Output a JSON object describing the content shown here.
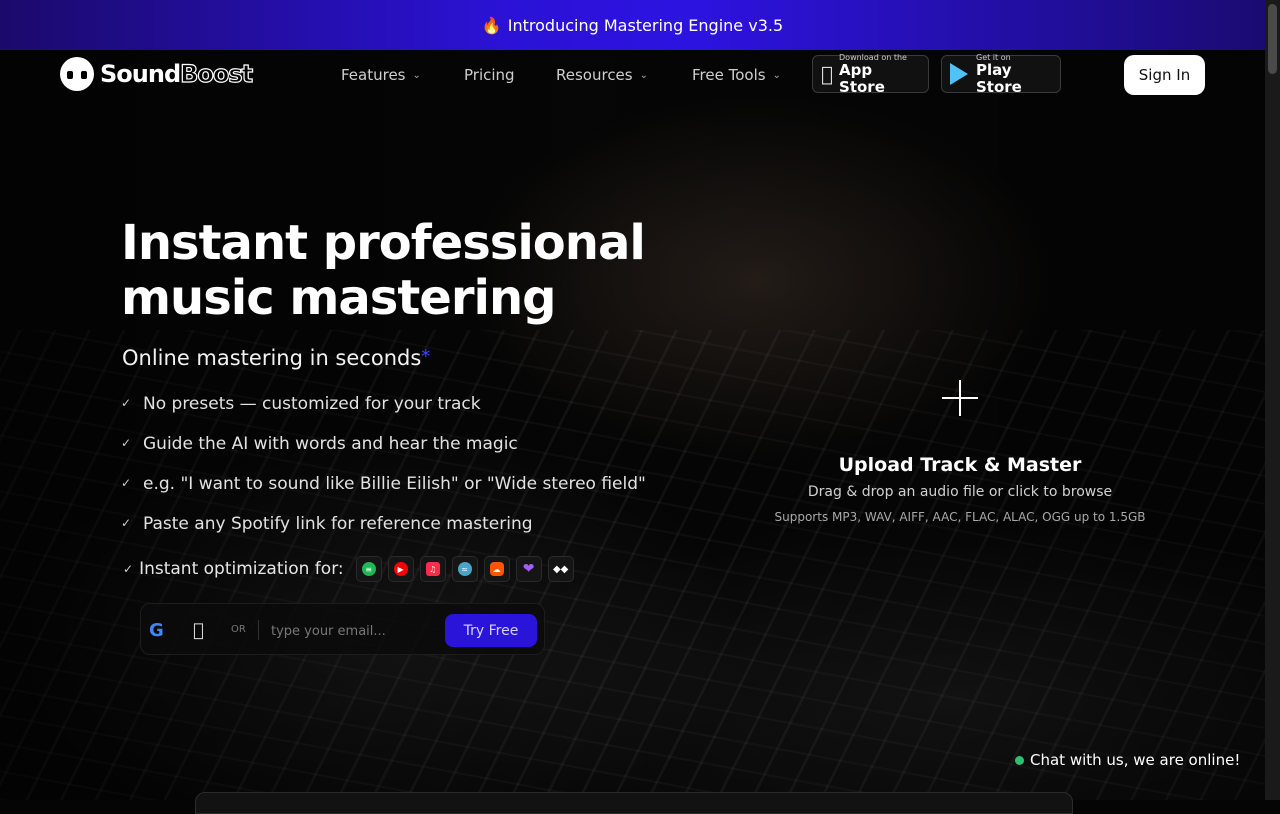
{
  "announcement": {
    "icon": "fire-icon",
    "text": "Introducing Mastering Engine v3.5"
  },
  "nav": {
    "logo_text_solid": "Sound",
    "logo_text_outline": "Boost",
    "items": [
      {
        "label": "Features",
        "has_dropdown": true
      },
      {
        "label": "Pricing",
        "has_dropdown": false
      },
      {
        "label": "Resources",
        "has_dropdown": true
      },
      {
        "label": "Free Tools",
        "has_dropdown": true
      }
    ],
    "app_store": {
      "small": "Download on the",
      "big": "App Store"
    },
    "play_store": {
      "small": "Get it on",
      "big": "Play Store"
    },
    "signin_label": "Sign In"
  },
  "hero": {
    "title_line1": "Instant professional",
    "title_line2": "music mastering",
    "subtitle": "Online mastering in seconds",
    "subtitle_mark": "*",
    "features": [
      "No presets — customized for your track",
      "Guide the AI with words and hear the magic",
      "e.g. \"I want to sound like Billie Eilish\" or \"Wide stereo field\"",
      "Paste any Spotify link for reference mastering"
    ],
    "optimization_label": "Instant optimization for:",
    "platforms": [
      "spotify-icon",
      "youtube-music-icon",
      "apple-music-icon",
      "tidal-wave-icon",
      "soundcloud-icon",
      "heart-icon",
      "tidal-icon"
    ]
  },
  "signup": {
    "or_label": "OR",
    "email_placeholder": "type your email...",
    "try_label": "Try Free"
  },
  "upload": {
    "title": "Upload Track & Master",
    "description": "Drag & drop an audio file or click to browse",
    "formats": "Supports MP3, WAV, AIFF, AAC, FLAC, ALAC, OGG up to 1.5GB"
  },
  "chat": {
    "label": "Chat with us, we are online!"
  },
  "colors": {
    "accent": "#2a14d9",
    "announce_bar": "#2d13e0",
    "online": "#2fbf71"
  }
}
